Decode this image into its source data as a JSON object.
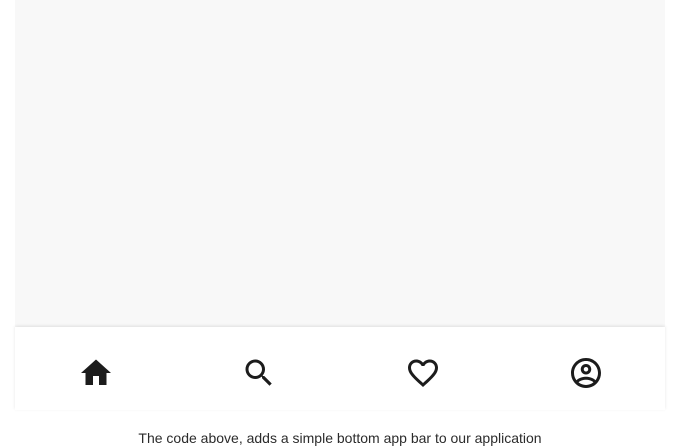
{
  "bottom_nav": {
    "items": [
      {
        "id": "home",
        "icon": "home-icon"
      },
      {
        "id": "search",
        "icon": "search-icon"
      },
      {
        "id": "favorites",
        "icon": "heart-icon"
      },
      {
        "id": "profile",
        "icon": "account-circle-icon"
      }
    ],
    "icon_color": "#1c1c1c"
  },
  "caption": "The code above, adds a simple bottom app bar to our application"
}
